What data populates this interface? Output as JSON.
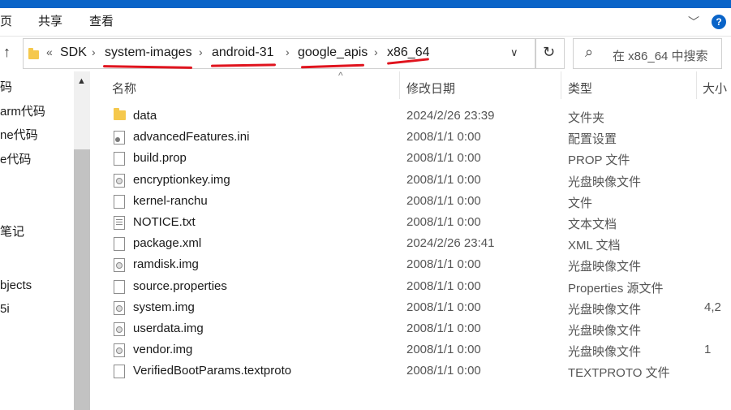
{
  "ribbon": {
    "tabs": [
      "页",
      "共享",
      "查看"
    ]
  },
  "address": {
    "overflow": "«",
    "crumbs": [
      "SDK",
      "system-images",
      "android-31",
      "google_apis",
      "x86_64"
    ]
  },
  "search": {
    "placeholder": "在 x86_64 中搜索"
  },
  "nav": {
    "items": [
      "码",
      "arm代码",
      "ne代码",
      "e代码",
      "笔记",
      "bjects",
      "5i"
    ]
  },
  "columns": {
    "name": "名称",
    "date": "修改日期",
    "type": "类型",
    "size": "大小"
  },
  "files": [
    {
      "name": "data",
      "date": "2024/2/26 23:39",
      "type": "文件夹",
      "size": "",
      "icon": "folder-icon"
    },
    {
      "name": "advancedFeatures.ini",
      "date": "2008/1/1 0:00",
      "type": "配置设置",
      "size": "",
      "icon": "config-file-icon"
    },
    {
      "name": "build.prop",
      "date": "2008/1/1 0:00",
      "type": "PROP 文件",
      "size": "",
      "icon": "file-icon"
    },
    {
      "name": "encryptionkey.img",
      "date": "2008/1/1 0:00",
      "type": "光盘映像文件",
      "size": "",
      "icon": "disc-image-icon"
    },
    {
      "name": "kernel-ranchu",
      "date": "2008/1/1 0:00",
      "type": "文件",
      "size": "",
      "icon": "file-icon"
    },
    {
      "name": "NOTICE.txt",
      "date": "2008/1/1 0:00",
      "type": "文本文档",
      "size": "",
      "icon": "text-file-icon"
    },
    {
      "name": "package.xml",
      "date": "2024/2/26 23:41",
      "type": "XML 文档",
      "size": "",
      "icon": "file-icon"
    },
    {
      "name": "ramdisk.img",
      "date": "2008/1/1 0:00",
      "type": "光盘映像文件",
      "size": "",
      "icon": "disc-image-icon"
    },
    {
      "name": "source.properties",
      "date": "2008/1/1 0:00",
      "type": "Properties 源文件",
      "size": "",
      "icon": "file-icon"
    },
    {
      "name": "system.img",
      "date": "2008/1/1 0:00",
      "type": "光盘映像文件",
      "size": "4,2",
      "icon": "disc-image-icon"
    },
    {
      "name": "userdata.img",
      "date": "2008/1/1 0:00",
      "type": "光盘映像文件",
      "size": "",
      "icon": "disc-image-icon"
    },
    {
      "name": "vendor.img",
      "date": "2008/1/1 0:00",
      "type": "光盘映像文件",
      "size": "1",
      "icon": "disc-image-icon"
    },
    {
      "name": "VerifiedBootParams.textproto",
      "date": "2008/1/1 0:00",
      "type": "TEXTPROTO 文件",
      "size": "",
      "icon": "file-icon"
    }
  ],
  "colors": {
    "accent": "#0a64c8",
    "annotation": "#e0141e",
    "folder": "#f5c84c"
  }
}
